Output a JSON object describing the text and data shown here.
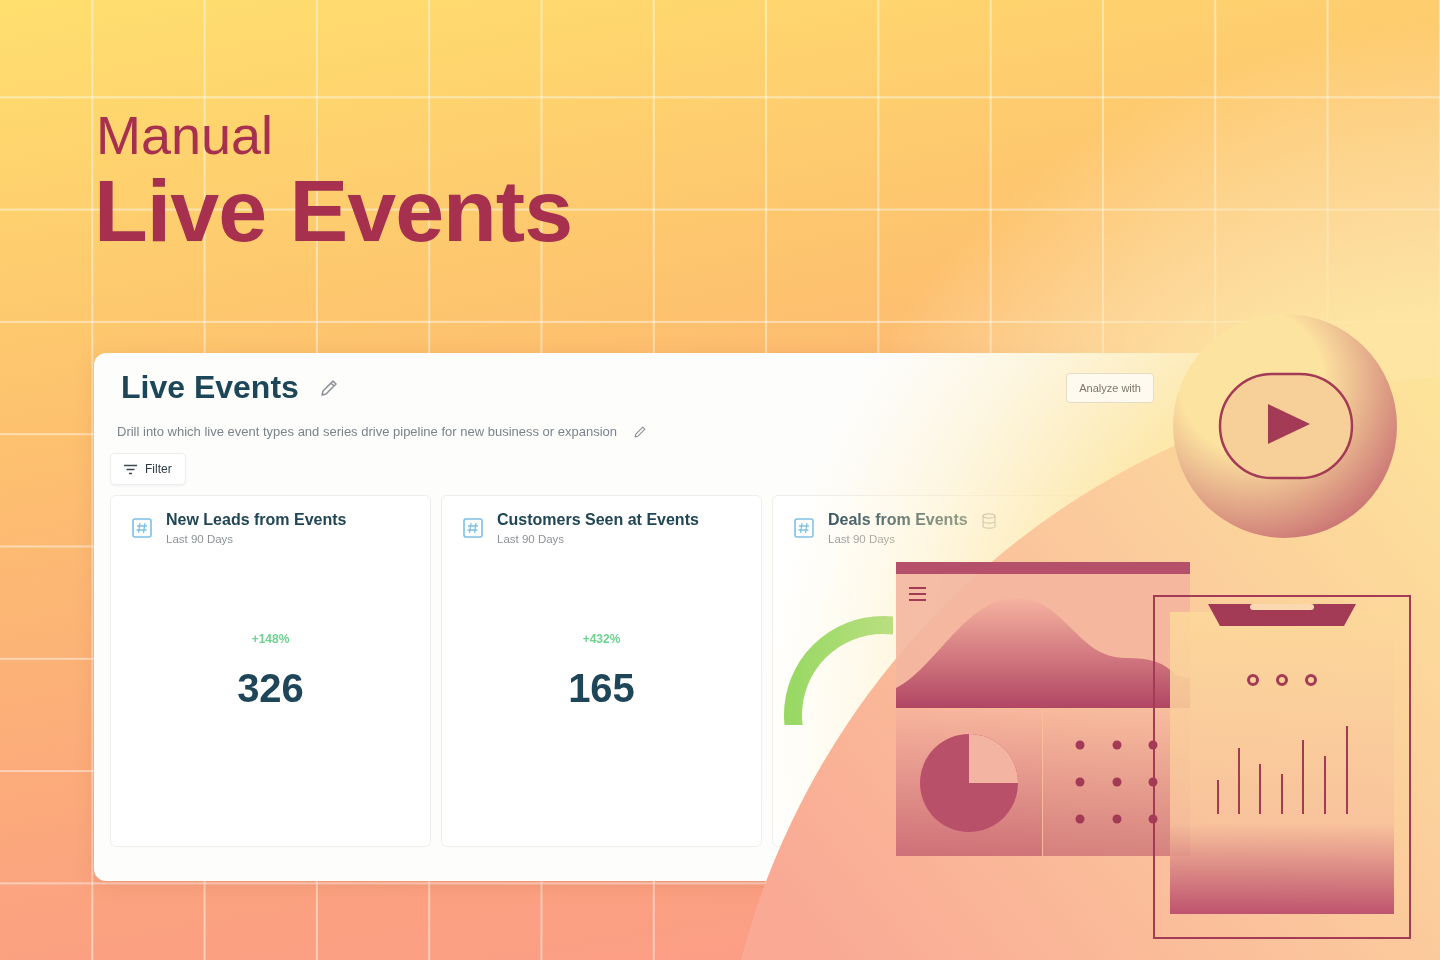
{
  "headline": {
    "kicker": "Manual",
    "title": "Live Events"
  },
  "dashboard": {
    "title": "Live Events",
    "description": "Drill into which live event types and series drive pipeline for new business or expansion",
    "filter_label": "Filter",
    "analyze_label": "Analyze with"
  },
  "cards": [
    {
      "kind": "number",
      "title": "New Leads from Events",
      "subtitle": "Last 90 Days",
      "change": "+148%",
      "value": "326"
    },
    {
      "kind": "number",
      "title": "Customers Seen at Events",
      "subtitle": "Last 90 Days",
      "change": "+432%",
      "value": "165"
    },
    {
      "kind": "chart",
      "title": "Deals from Events",
      "subtitle": "Last 90 Days"
    }
  ]
}
